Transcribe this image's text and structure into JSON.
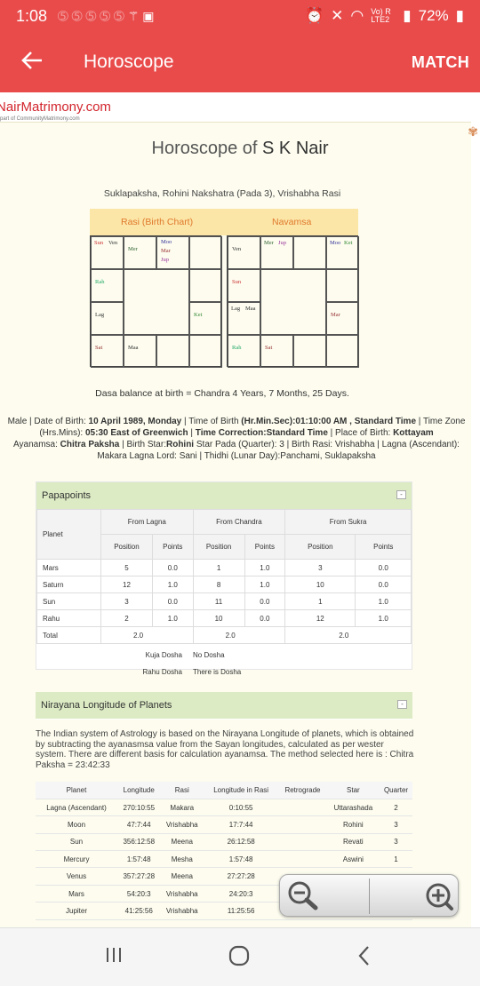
{
  "status_bar": {
    "time": "1:08",
    "battery": "72%",
    "signal_label": "Vo) R LTE2"
  },
  "app_bar": {
    "title": "Horoscope",
    "match_label": "MATCH"
  },
  "logo": {
    "brand": "NairMatrimony.com",
    "tagline": "part of CommunityMatrimony.com"
  },
  "page": {
    "title_prefix": "Horoscope of",
    "name": "S K Nair",
    "subtitle": "Suklapaksha, Rohini Nakshatra (Pada 3), Vrishabha Rasi",
    "rasi_label": "Rasi (Birth Chart)",
    "navamsa_label": "Navamsa",
    "dasa": "Dasa balance at birth = Chandra 4 Years, 7 Months, 25 Days.",
    "details": {
      "l1a": "Male | Date of Birth: ",
      "l1b": "10 April 1989, Monday",
      "l1c": " | Time of Birth ",
      "l1d": "(Hr.Min.Sec):01:10:00 AM , Standard Time",
      "l1e": " | Time Zone",
      "l2a": "(Hrs.Mins): ",
      "l2b": "05:30 East of Greenwich",
      "l2c": " | ",
      "l2d": "Time Correction:",
      "l2e": "Standard Time",
      "l2f": " | Place of Birth: ",
      "l2g": "Kottayam",
      "l3a": "Ayanamsa: ",
      "l3b": "Chitra Paksha",
      "l3c": " | Birth Star:",
      "l3d": "Rohini",
      "l3e": " Star Pada (Quarter): 3 | Birth Rasi: Vrishabha | Lagna (Ascendant):",
      "l4": "Makara Lagna Lord: Sani | Thidhi (Lunar Day):Panchami, Suklapaksha"
    }
  },
  "rasi_chart": {
    "c0": [
      "Sun",
      "Ven"
    ],
    "c1": [
      "Mer"
    ],
    "c2": [
      "Moo",
      "Mar",
      "Jup"
    ],
    "c3": [],
    "c4": [
      "Rah"
    ],
    "c5": [],
    "c6": [
      "Lag"
    ],
    "c7": [
      "Ket"
    ],
    "c8": [
      "Sat"
    ],
    "c9": [
      "Maa"
    ],
    "c10": [],
    "c11": []
  },
  "navamsa_chart": {
    "c0": [
      "Ven"
    ],
    "c1": [
      "Mer",
      "Jup"
    ],
    "c2": [],
    "c3": [
      "Moo",
      "Ket"
    ],
    "c4": [
      "Sun"
    ],
    "c5": [],
    "c6": [
      "Lag",
      "Maa"
    ],
    "c7": [
      "Mar"
    ],
    "c8": [
      "Rah"
    ],
    "c9": [
      "Sat"
    ],
    "c10": [],
    "c11": []
  },
  "papapoints": {
    "title": "Papapoints",
    "collapse": "-",
    "planet_header": "Planet",
    "groups": [
      "From Lagna",
      "From Chandra",
      "From Sukra"
    ],
    "sub_position": "Position",
    "sub_points": "Points",
    "rows": [
      {
        "planet": "Mars",
        "v": [
          "5",
          "0.0",
          "1",
          "1.0",
          "3",
          "0.0"
        ]
      },
      {
        "planet": "Saturn",
        "v": [
          "12",
          "1.0",
          "8",
          "1.0",
          "10",
          "0.0"
        ]
      },
      {
        "planet": "Sun",
        "v": [
          "3",
          "0.0",
          "11",
          "0.0",
          "1",
          "1.0"
        ]
      },
      {
        "planet": "Rahu",
        "v": [
          "2",
          "1.0",
          "10",
          "0.0",
          "12",
          "1.0"
        ]
      }
    ],
    "total_label": "Total",
    "totals": [
      "2.0",
      "2.0",
      "2.0"
    ],
    "dosha": [
      {
        "label": "Kuja Dosha",
        "value": "No Dosha"
      },
      {
        "label": "Rahu Dosha",
        "value": "There is Dosha"
      }
    ]
  },
  "nirayana": {
    "title": "Nirayana Longitude of Planets",
    "collapse": "-",
    "text": "The Indian system of Astrology is based on the Nirayana Longitude of planets, which is obtained by subtracting the ayanasmsa value from the Sayan longitudes, calculated as per wester system. There are different basis for calculation ayanamsa. The method selected here is : Chitra Paksha = 23:42:33",
    "headers": [
      "Planet",
      "Longitude",
      "Rasi",
      "Longitude in Rasi",
      "Retrograde",
      "Star",
      "Quarter"
    ],
    "rows": [
      [
        "Lagna (Ascendant)",
        "270:10:55",
        "Makara",
        "0:10:55",
        "",
        "Uttarashada",
        "2"
      ],
      [
        "Moon",
        "47:7:44",
        "Vrishabha",
        "17:7:44",
        "",
        "Rohini",
        "3"
      ],
      [
        "Sun",
        "356:12:58",
        "Meena",
        "26:12:58",
        "",
        "Revati",
        "3"
      ],
      [
        "Mercury",
        "1:57:48",
        "Mesha",
        "1:57:48",
        "",
        "Aswini",
        "1"
      ],
      [
        "Venus",
        "357:27:28",
        "Meena",
        "27:27:28",
        "",
        "",
        ""
      ],
      [
        "Mars",
        "54:20:3",
        "Vrishabha",
        "24:20:3",
        "",
        "",
        ""
      ],
      [
        "Jupiter",
        "41:25:56",
        "Vrishabha",
        "11:25:56",
        "",
        "",
        ""
      ]
    ]
  },
  "icons": {
    "back": "arrow-left-icon",
    "zoom_out": "zoom-out-icon",
    "zoom_in": "zoom-in-icon",
    "nav_recents": "recents-icon",
    "nav_home": "home-icon",
    "nav_back": "back-chevron-icon"
  },
  "colors": {
    "accent": "#e94b4b",
    "panel_header": "#dcebc4",
    "chart_header": "#fbe6a8",
    "chart_label": "#e0782a",
    "logo": "#d2252d"
  }
}
